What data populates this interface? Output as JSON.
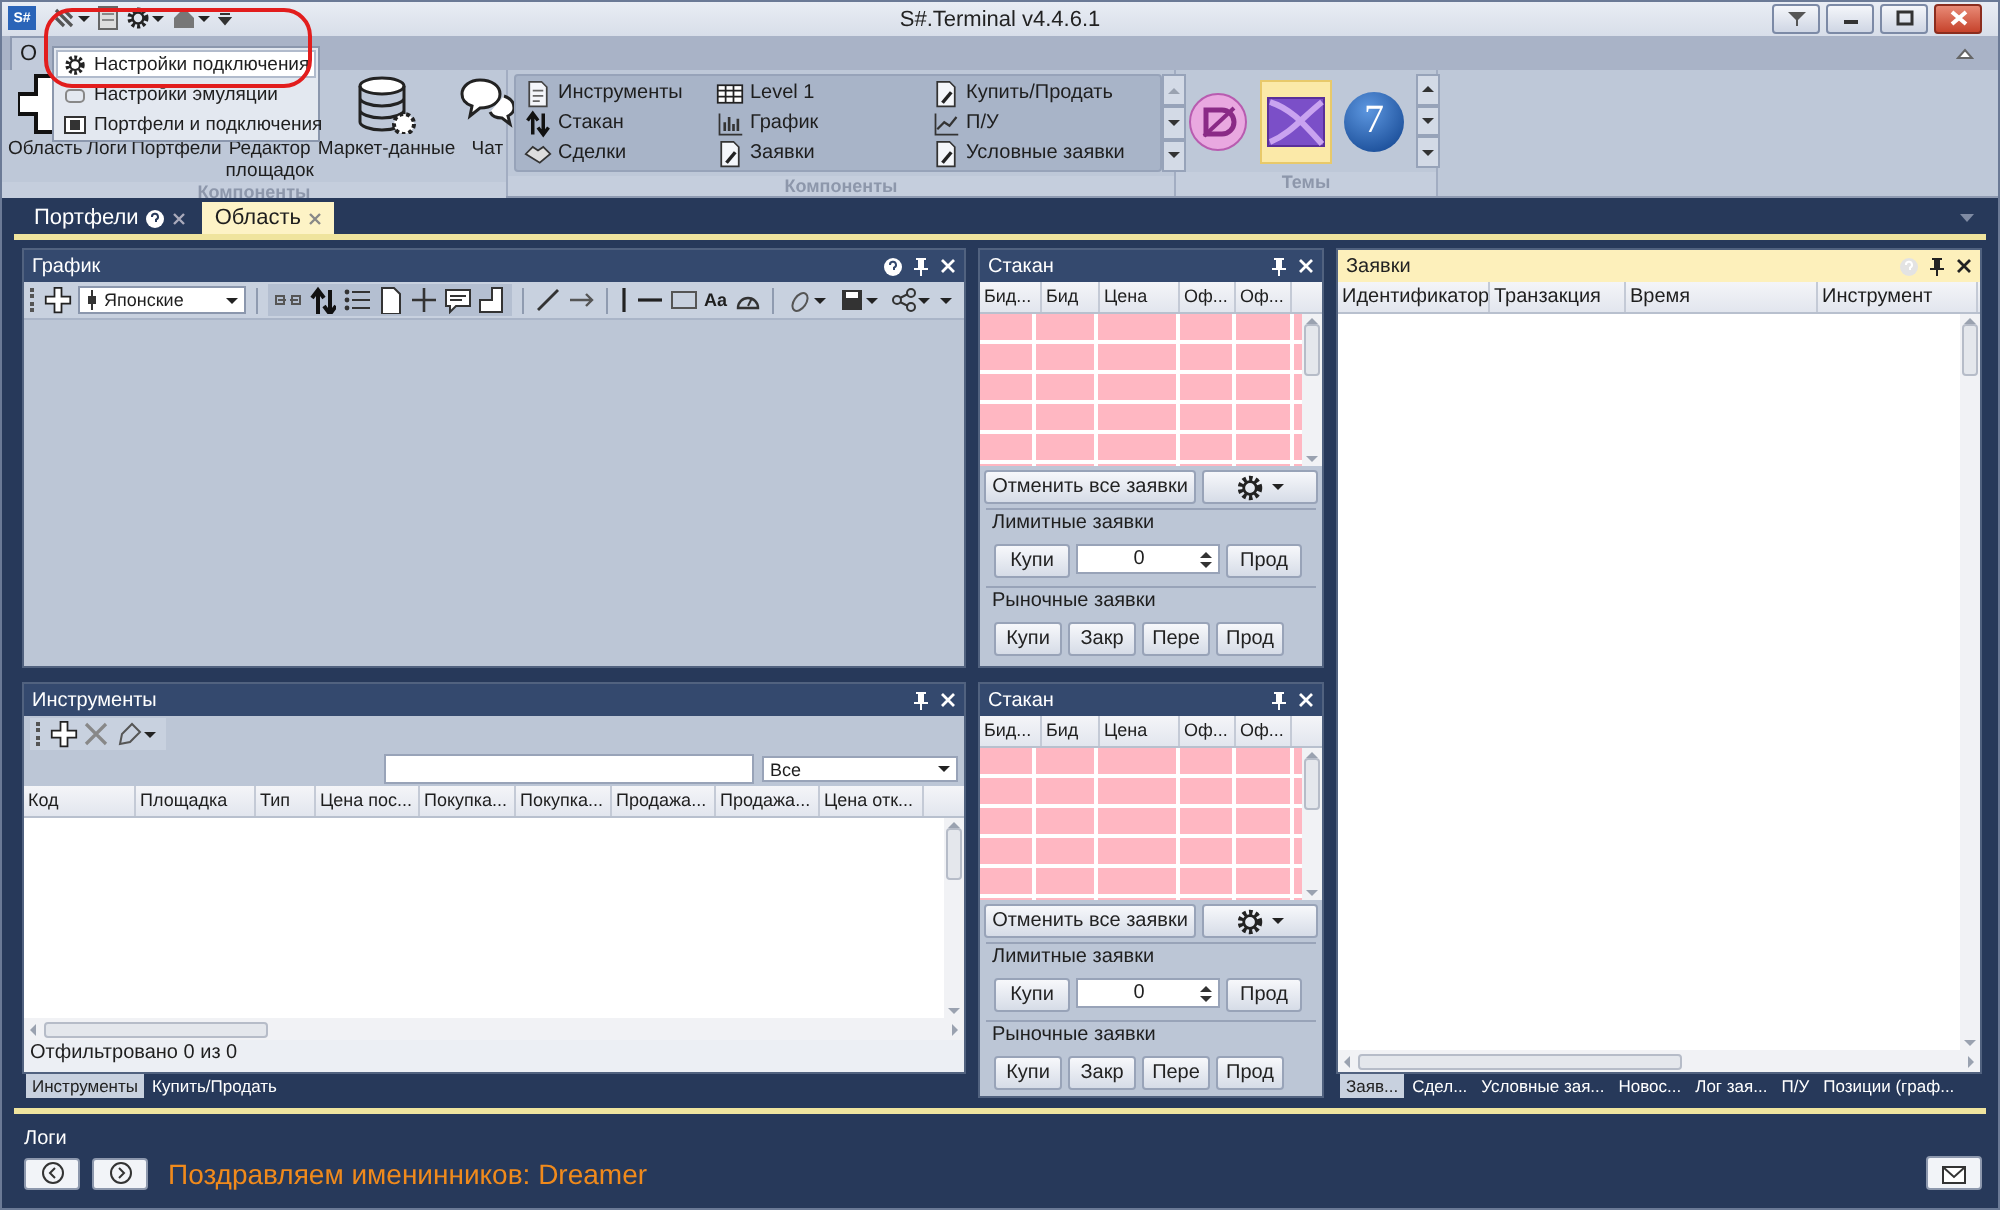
{
  "window": {
    "app_icon": "S#",
    "title": "S#.Terminal v4.4.6.1"
  },
  "quick_menu": [
    {
      "label": "Настройки подключения",
      "selected": true
    },
    {
      "label": "Настройки эмуляции",
      "selected": false
    },
    {
      "label": "Портфели и подключения",
      "selected": false
    }
  ],
  "ribbon_tabs": [
    {
      "label": "О",
      "selected": true
    }
  ],
  "ribbon_components": {
    "title": "Компоненты",
    "items": [
      "Область",
      "Логи",
      "Портфели",
      "Редактор площадок",
      "Маркет-данные",
      "Чат"
    ]
  },
  "ribbon_gallery": {
    "title": "Компоненты",
    "items": [
      "Инструменты",
      "Level 1",
      "Купить/Продать",
      "Стакан",
      "График",
      "П/У",
      "Сделки",
      "Заявки",
      "Условные заявки"
    ]
  },
  "ribbon_themes": {
    "title": "Темы",
    "items": [
      {
        "kind": "office",
        "selected": false
      },
      {
        "kind": "metro",
        "selected": true
      },
      {
        "kind": "seven",
        "glyph": "7",
        "selected": false
      }
    ]
  },
  "document_tabs": [
    {
      "label": "Портфели",
      "selected": false,
      "help": true
    },
    {
      "label": "Область",
      "selected": true,
      "help": false
    }
  ],
  "chart_panel": {
    "title": "График",
    "active": false,
    "help": true,
    "chart_style": "Японские",
    "text_tool": "Aa"
  },
  "order_books": [
    {
      "title": "Стакан",
      "active": false,
      "help": false,
      "columns": [
        "Бид...",
        "Бид",
        "Цена",
        "Оф...",
        "Оф..."
      ],
      "cancel_button": "Отменить все заявки",
      "limit_title": "Лимитные заявки",
      "limit_buy": "Купи",
      "volume": "0",
      "limit_sell": "Прод",
      "market_title": "Рыночные заявки",
      "market_buttons": [
        "Купи",
        "Закр",
        "Пере",
        "Прод"
      ]
    },
    {
      "title": "Стакан",
      "active": false,
      "help": false,
      "columns": [
        "Бид...",
        "Бид",
        "Цена",
        "Оф...",
        "Оф..."
      ],
      "cancel_button": "Отменить все заявки",
      "limit_title": "Лимитные заявки",
      "limit_buy": "Купи",
      "volume": "0",
      "limit_sell": "Прод",
      "market_title": "Рыночные заявки",
      "market_buttons": [
        "Купи",
        "Закр",
        "Пере",
        "Прод"
      ]
    }
  ],
  "instruments_panel": {
    "title": "Инструменты",
    "active": false,
    "help": false,
    "market_filter": "Все",
    "columns": [
      "Код",
      "Площадка",
      "Тип",
      "Цена пос...",
      "Покупка...",
      "Покупка...",
      "Продажа...",
      "Продажа...",
      "Цена отк..."
    ],
    "status": "Отфильтровано 0 из 0",
    "tabs": [
      {
        "label": "Инструменты",
        "selected": true
      },
      {
        "label": "Купить/Продать",
        "selected": false
      }
    ]
  },
  "orders_panel": {
    "title": "Заявки",
    "active": true,
    "help": true,
    "columns": [
      "Идентификатор",
      "Транзакция",
      "Время",
      "Инструмент"
    ],
    "tabs": [
      {
        "label": "Заяв...",
        "selected": true
      },
      {
        "label": "Сдел...",
        "selected": false
      },
      {
        "label": "Условные зая...",
        "selected": false
      },
      {
        "label": "Новос...",
        "selected": false
      },
      {
        "label": "Лог зая...",
        "selected": false
      },
      {
        "label": "П/У",
        "selected": false
      },
      {
        "label": "Позиции (граф...",
        "selected": false
      }
    ]
  },
  "logs": {
    "title": "Логи",
    "message": "Поздравляем именинников: Dreamer"
  }
}
